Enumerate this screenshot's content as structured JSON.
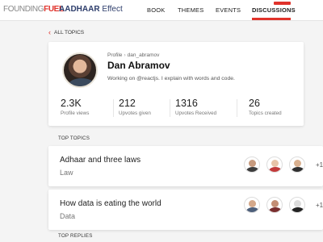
{
  "header": {
    "brand_prefix": "FOUNDING",
    "brand_accent": "FUEL",
    "product_title": "AADHAAR",
    "product_subtitle": "Effect",
    "nav": [
      "BOOK",
      "THEMES",
      "EVENTS",
      "DISCUSSIONS"
    ],
    "active_nav": "DISCUSSIONS"
  },
  "back_link": "ALL TOPICS",
  "profile": {
    "breadcrumb": [
      "Profile",
      "dan_abramov"
    ],
    "name": "Dan Abramov",
    "bio": "Working on @reactjs. I explain with words and code.",
    "stats": [
      {
        "value": "2.3K",
        "label": "Profile views"
      },
      {
        "value": "212",
        "label": "Upvotes given"
      },
      {
        "value": "1316",
        "label": "Upvotes Received"
      },
      {
        "value": "26",
        "label": "Topics created"
      }
    ]
  },
  "top_topics": {
    "heading": "TOP TOPICS",
    "items": [
      {
        "title": "Adhaar and three laws",
        "category": "Law",
        "more": "+1"
      },
      {
        "title": "How data is eating the world",
        "category": "Data",
        "more": "+1"
      }
    ]
  },
  "top_replies": {
    "heading": "TOP REPLIES"
  },
  "colors": {
    "accent": "#e0322b",
    "brand_blue": "#2d3d6b",
    "background": "#f4f4f4"
  },
  "icons": {
    "back": "chevron-left-icon"
  }
}
